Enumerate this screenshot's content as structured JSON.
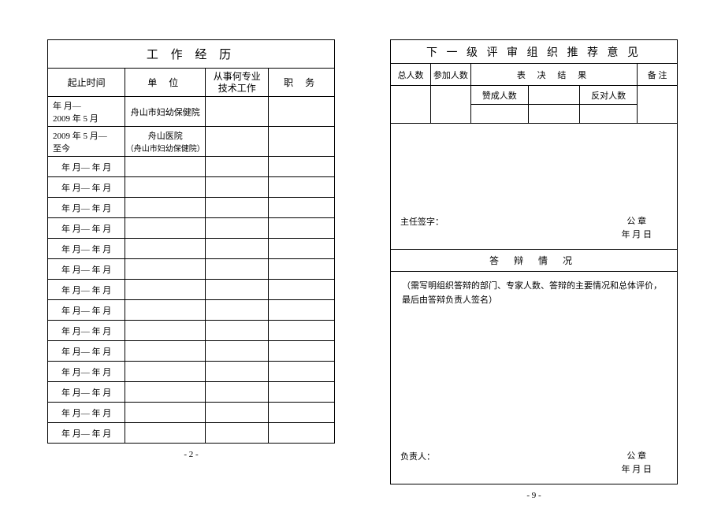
{
  "left": {
    "title": "工 作 经 历",
    "headers": {
      "time": "起止时间",
      "unit": "单 位",
      "tech_line1": "从事何专业",
      "tech_line2": "技术工作",
      "position": "职 务"
    },
    "rows": [
      {
        "time": "年 月—\n2009 年 5 月",
        "unit": "舟山市妇幼保健院",
        "tech": "",
        "pos": ""
      },
      {
        "time": "2009 年 5 月—\n至今",
        "unit": "舟山医院\n（舟山市妇幼保健院）",
        "tech": "",
        "pos": ""
      },
      {
        "time": "年 月— 年 月",
        "unit": "",
        "tech": "",
        "pos": ""
      },
      {
        "time": "年 月— 年 月",
        "unit": "",
        "tech": "",
        "pos": ""
      },
      {
        "time": "年 月— 年 月",
        "unit": "",
        "tech": "",
        "pos": ""
      },
      {
        "time": "年 月— 年 月",
        "unit": "",
        "tech": "",
        "pos": ""
      },
      {
        "time": "年 月— 年 月",
        "unit": "",
        "tech": "",
        "pos": ""
      },
      {
        "time": "年 月— 年 月",
        "unit": "",
        "tech": "",
        "pos": ""
      },
      {
        "time": "年 月— 年 月",
        "unit": "",
        "tech": "",
        "pos": ""
      },
      {
        "time": "年 月— 年 月",
        "unit": "",
        "tech": "",
        "pos": ""
      },
      {
        "time": "年 月— 年 月",
        "unit": "",
        "tech": "",
        "pos": ""
      },
      {
        "time": "年 月— 年 月",
        "unit": "",
        "tech": "",
        "pos": ""
      },
      {
        "time": "年 月— 年 月",
        "unit": "",
        "tech": "",
        "pos": ""
      },
      {
        "time": "年 月— 年 月",
        "unit": "",
        "tech": "",
        "pos": ""
      },
      {
        "time": "年 月— 年 月",
        "unit": "",
        "tech": "",
        "pos": ""
      },
      {
        "time": "年 月— 年 月",
        "unit": "",
        "tech": "",
        "pos": ""
      }
    ],
    "page_no": "- 2 -"
  },
  "right": {
    "title": "下 一 级 评 审 组 织 推 荐 意 见",
    "headers": {
      "total": "总人数",
      "participants": "参加人数",
      "result": "表 决 结 果",
      "remark": "备 注",
      "agree": "赞成人数",
      "oppose": "反对人数"
    },
    "sig1_left": "主任签字：",
    "seal": "公 章",
    "date": "年  月  日",
    "defense_title": "答 辩 情 况",
    "defense_body": "（需写明组织答辩的部门、专家人数、答辩的主要情况和总体评价，最后由答辩负责人签名）",
    "sig2_left": "负责人：",
    "page_no": "- 9 -"
  }
}
